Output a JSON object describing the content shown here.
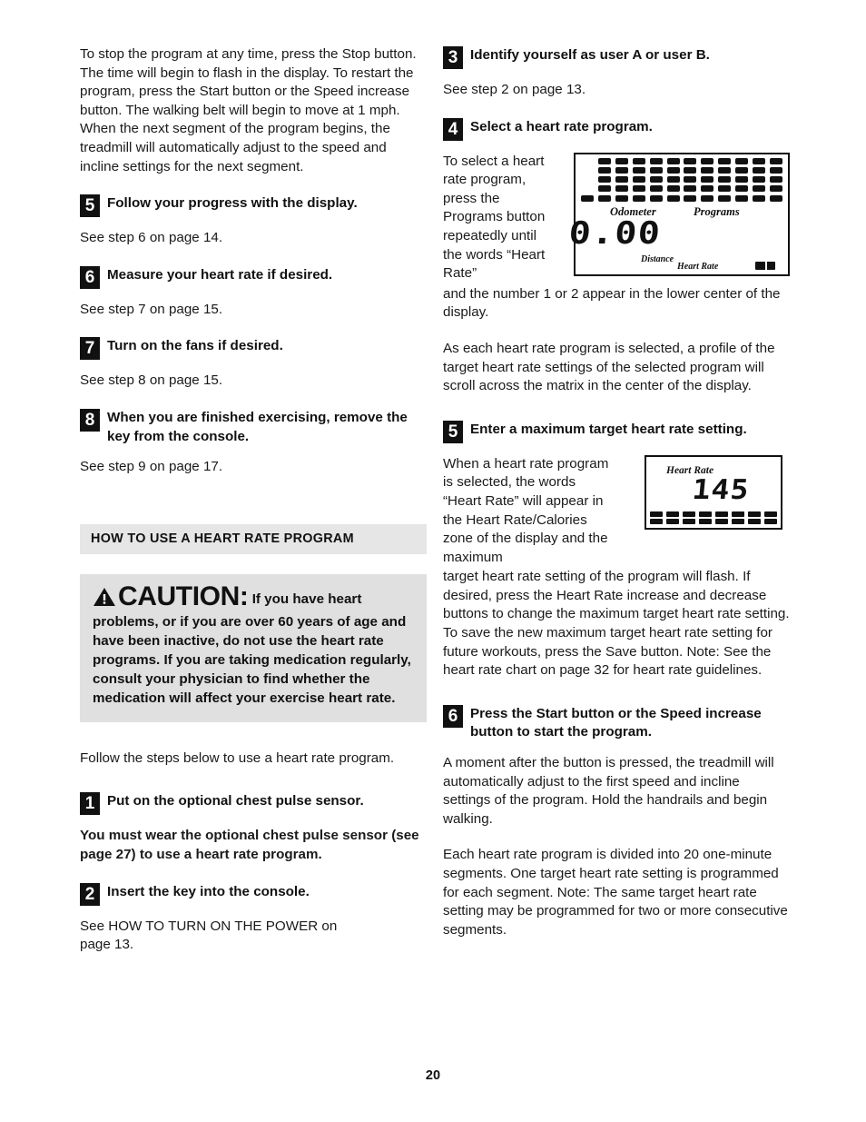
{
  "page": {
    "number": "20"
  },
  "left_column": {
    "intro_paragraph": "To stop the program at any time, press the Stop button. The time will begin to flash in the display. To restart the program, press the Start button or the Speed increase button. The walking belt will begin to move at 1 mph. When the next segment of the program begins, the treadmill will automatically adjust to the speed and incline settings for the next segment.",
    "steps": [
      {
        "number": "5",
        "title": "Follow your progress with the display.",
        "body": "See step 6 on page 14."
      },
      {
        "number": "6",
        "title": "Measure your heart rate if desired.",
        "body": "See step 7 on page 15."
      },
      {
        "number": "7",
        "title": "Turn on the fans if desired.",
        "body": "See step 8 on page 15."
      },
      {
        "number": "8",
        "title": "When you are finished exercising, remove the key from the console.",
        "body": "See step 9 on page 17."
      }
    ],
    "section_heading": "HOW TO USE A HEART RATE PROGRAM",
    "caution": {
      "icon": "warning-triangle-icon",
      "word": "CAUTION:",
      "text": "If you have heart problems, or if you are over 60 years of age and have been inactive, do not use the heart rate programs. If you are taking medication regularly, consult your physician to find whether the medication will affect your exercise heart rate."
    },
    "follow_steps_intro": "Follow the steps below to use a heart rate program.",
    "hr_steps": [
      {
        "number": "1",
        "title": "Put on the optional chest pulse sensor.",
        "body": "You must wear the optional chest pulse sensor (see page 27) to use a heart rate program."
      },
      {
        "number": "2",
        "title": "Insert the key into the console.",
        "body": "See HOW TO TURN ON THE POWER on page 13."
      }
    ]
  },
  "right_column": {
    "steps": [
      {
        "number": "3",
        "title": "Identify yourself as user A or user B.",
        "body": "See step 2 on page 13."
      },
      {
        "number": "4",
        "title": "Select a heart rate program.",
        "body_narrow": "To select a heart rate program, press the Programs button repeatedly until the words “Heart Rate”",
        "body_cont": "and the number 1 or 2 appear in the lower center of the display.",
        "body_para2": "As each heart rate program is selected, a profile of the target heart rate settings of the selected program will scroll across the matrix in the center of the display."
      },
      {
        "number": "5",
        "title": "Enter a maximum target heart rate setting.",
        "body_narrow": "When a heart rate program is selected, the words “Heart Rate” will appear in the Heart Rate/Calories zone of the display and the maximum",
        "body_cont": "target heart rate setting of the program will flash. If desired, press the Heart Rate increase and decrease buttons to change the maximum target heart rate setting. To save the new maximum target heart rate setting for future workouts, press the Save button. Note: See the heart rate chart on page 32 for heart rate guidelines."
      },
      {
        "number": "6",
        "title": "Press the Start button or the Speed increase button to start the program.",
        "body_para1": "A moment after the button is pressed, the treadmill will automatically adjust to the first speed and incline settings of the program. Hold the handrails and begin walking.",
        "body_para2": "Each heart rate program is divided into 20 one-minute segments. One target heart rate setting is programmed for each segment. Note: The same target heart rate setting may be programmed for two or more consecutive segments."
      }
    ],
    "console_display": {
      "label_odometer": "Odometer",
      "label_programs": "Programs",
      "value_distance": "0.00",
      "label_distance": "Distance",
      "label_heart_rate": "Heart Rate",
      "matrix_columns": 12,
      "matrix_rows": 5
    },
    "heart_rate_display": {
      "label_heart_rate": "Heart Rate",
      "value": "145",
      "bar_segments": 8
    }
  }
}
